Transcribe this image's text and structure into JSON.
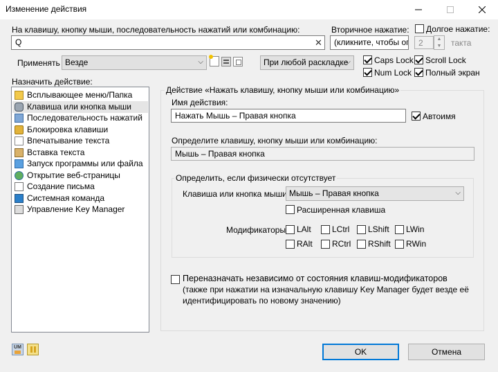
{
  "window": {
    "title": "Изменение действия"
  },
  "top": {
    "key_prompt": "На клавишу, кнопку мыши, последовательность нажатий или комбинацию:",
    "key_value": "Q",
    "secondary_label": "Вторичное нажатие:",
    "secondary_value": "(кликните, чтобы оп|",
    "long_press_label": "Долгое нажатие:",
    "long_press_value": "2",
    "takts_label": "такта",
    "apply_label": "Применять",
    "apply_value": "Везде",
    "layout_value": "При любой раскладке",
    "caps_lock": "Caps Lock",
    "num_lock": "Num Lock",
    "scroll_lock": "Scroll Lock",
    "full_screen": "Полный экран"
  },
  "actions": {
    "label": "Назначить действие:",
    "items": [
      {
        "label": "Всплывающее меню/Папка",
        "icon": "folder-icon"
      },
      {
        "label": "Клавиша или кнопка мыши",
        "icon": "mouse-icon"
      },
      {
        "label": "Последовательность нажатий",
        "icon": "sequence-icon"
      },
      {
        "label": "Блокировка клавиши",
        "icon": "lock-icon"
      },
      {
        "label": "Впечатывание текста",
        "icon": "type-text-icon"
      },
      {
        "label": "Вставка текста",
        "icon": "paste-icon"
      },
      {
        "label": "Запуск программы или файла",
        "icon": "run-icon"
      },
      {
        "label": "Открытие веб-страницы",
        "icon": "globe-icon"
      },
      {
        "label": "Создание письма",
        "icon": "mail-icon"
      },
      {
        "label": "Системная команда",
        "icon": "monitor-icon"
      },
      {
        "label": "Управление Key Manager",
        "icon": "keymanager-icon"
      }
    ]
  },
  "detail": {
    "group_title": "Действие «Нажать клавишу, кнопку мыши или комбинацию»",
    "name_label": "Имя действия:",
    "name_value": "Нажать Мышь – Правая кнопка",
    "autoname_label": "Автоимя",
    "define_label": "Определите клавишу, кнопку мыши или комбинацию:",
    "define_value": "Мышь – Правая кнопка",
    "absent_title": "Определить, если физически отсутствует",
    "key_or_mouse_label": "Клавиша или кнопка мыши",
    "key_or_mouse_value": "Мышь – Правая кнопка",
    "extended_key": "Расширенная клавиша",
    "modifiers_label": "Модификаторы",
    "modifiers": [
      "LAlt",
      "LCtrl",
      "LShift",
      "LWin",
      "RAlt",
      "RCtrl",
      "RShift",
      "RWin"
    ],
    "reassign_label": "Переназначать независимо от состояния клавиш-модификаторов",
    "reassign_note_1": "(также при нажатии на изначальную клавишу Key Manager будет везде её",
    "reassign_note_2": "идентифицировать по новому значению)"
  },
  "buttons": {
    "ok": "OK",
    "cancel": "Отмена"
  },
  "colors": {
    "accent": "#0078d7",
    "selected_row": "#e5e5e5"
  }
}
